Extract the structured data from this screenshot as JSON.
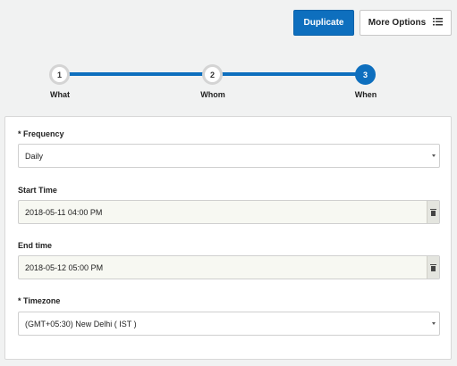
{
  "toolbar": {
    "duplicate_label": "Duplicate",
    "more_options_label": "More Options",
    "more_options_icon": "list-icon"
  },
  "stepper": {
    "steps": [
      {
        "number": "1",
        "label": "What",
        "state": "done"
      },
      {
        "number": "2",
        "label": "Whom",
        "state": "done"
      },
      {
        "number": "3",
        "label": "When",
        "state": "active"
      }
    ],
    "accent_color": "#0e6fbe"
  },
  "form": {
    "frequency": {
      "label": "* Frequency",
      "value": "Daily"
    },
    "start_time": {
      "label": "Start Time",
      "value": "2018-05-11 04:00 PM",
      "icon": "trash-icon"
    },
    "end_time": {
      "label": "End time",
      "value": "2018-05-12 05:00 PM",
      "icon": "trash-icon"
    },
    "timezone": {
      "label": "* Timezone",
      "value": "(GMT+05:30) New Delhi ( IST )"
    }
  }
}
